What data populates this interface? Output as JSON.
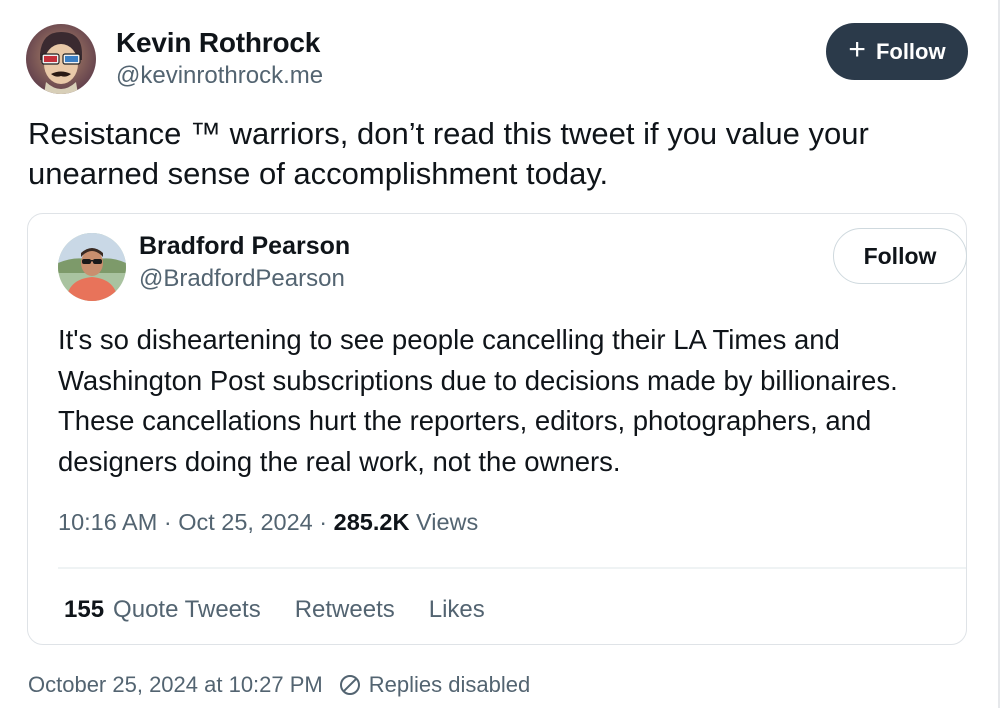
{
  "post": {
    "author": {
      "name": "Kevin Rothrock",
      "handle": "@kevinrothrock.me",
      "avatar_icon": "avatar-with-3d-glasses"
    },
    "follow_button": {
      "icon": "plus-icon",
      "label": "Follow"
    },
    "text": "Resistance ™ warriors, don’t read this tweet if you value your unearned sense of accomplishment today."
  },
  "embedded_tweet": {
    "author": {
      "name": "Bradford Pearson",
      "handle": "@BradfordPearson",
      "avatar_icon": "avatar-man-sunglasses"
    },
    "follow_label": "Follow",
    "text": "It's so disheartening to see people cancelling their LA Times and Washington Post subscriptions due to decisions made by billionaires. These cancellations hurt the reporters, editors, photographers, and designers doing the real work, not the owners.",
    "meta": {
      "time": "10:16 AM",
      "separator": " · ",
      "date": "Oct 25, 2024",
      "views_count": "285.2K",
      "views_label": "Views"
    },
    "stats": {
      "quote_tweets_count": "155",
      "quote_tweets_label": "Quote Tweets",
      "retweets_label": "Retweets",
      "likes_label": "Likes"
    }
  },
  "footer": {
    "timestamp": "October 25, 2024 at 10:27 PM",
    "replies_icon": "replies-disabled-icon",
    "replies_status": "Replies disabled"
  },
  "colors": {
    "text_primary": "#0f1419",
    "text_secondary": "#536471",
    "follow_dark": "#2b3a4a",
    "border": "#dfe3e7"
  }
}
